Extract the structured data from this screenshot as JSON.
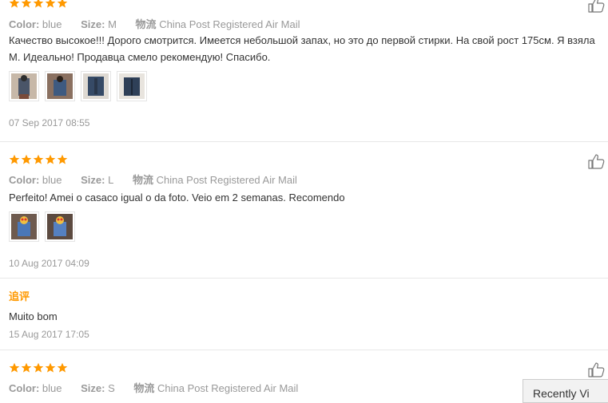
{
  "reviews": [
    {
      "color_label": "Color:",
      "color_value": "blue",
      "size_label": "Size:",
      "size_value": "M",
      "logistics_label": "物流",
      "logistics_value": "China Post Registered Air Mail",
      "text": "Качество высокое!!! Дорого смотрится. Имеется небольшой запах, но это до первой стирки. На свой рост 175см. Я взяла",
      "text2": "M. Идеально! Продавца смело рекомендую! Спасибо.",
      "date": "07 Sep 2017 08:55",
      "rating": 5
    },
    {
      "color_label": "Color:",
      "color_value": "blue",
      "size_label": "Size:",
      "size_value": "L",
      "logistics_label": "物流",
      "logistics_value": "China Post Registered Air Mail",
      "text": "Perfeito! Amei o casaco igual o da foto. Veio em 2 semanas. Recomendo",
      "date": "10 Aug 2017 04:09",
      "rating": 5,
      "append_title": "追评",
      "append_text": "Muito bom",
      "append_date": "15 Aug 2017 17:05"
    },
    {
      "color_label": "Color:",
      "color_value": "blue",
      "size_label": "Size:",
      "size_value": "S",
      "logistics_label": "物流",
      "logistics_value": "China Post Registered Air Mail",
      "rating": 5
    }
  ],
  "recently_viewed_label": "Recently Vi",
  "colors": {
    "star": "#f90",
    "muted": "#999",
    "append": "#f90"
  },
  "icons": {
    "like": "thumbs-up-icon",
    "star": "star-icon"
  }
}
